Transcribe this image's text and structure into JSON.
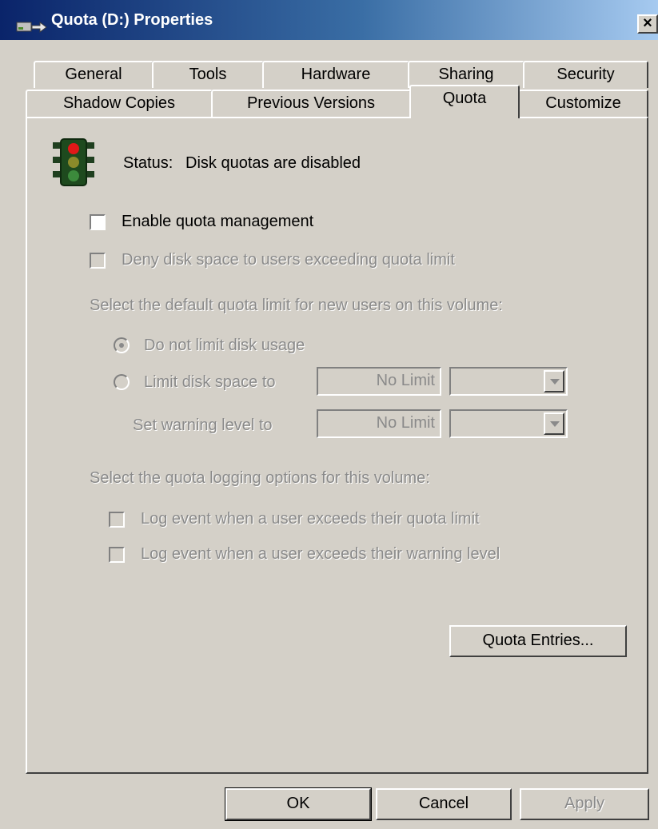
{
  "window": {
    "title": "Quota (D:) Properties",
    "close_glyph": "×"
  },
  "tabs": {
    "row1": [
      "General",
      "Tools",
      "Hardware",
      "Sharing",
      "Security"
    ],
    "row2": [
      "Shadow Copies",
      "Previous Versions",
      "Quota",
      "Customize"
    ],
    "selected": "Quota"
  },
  "quota": {
    "status_label": "Status:",
    "status_value": "Disk quotas are disabled",
    "status_icon": "traffic-light-icon",
    "enable_label": "Enable quota management",
    "enable_checked": false,
    "deny_label": "Deny disk space to users exceeding quota limit",
    "deny_checked": false,
    "default_limit_heading": "Select the default quota limit for new users on this volume:",
    "no_limit_label": "Do not limit disk usage",
    "no_limit_selected": true,
    "limit_label": "Limit disk space to",
    "limit_value": "No Limit",
    "warning_label": "Set warning level to",
    "warning_value": "No Limit",
    "logging_heading": "Select the quota logging options for this volume:",
    "log_limit_label": "Log event when a user exceeds their quota limit",
    "log_warning_label": "Log event when a user exceeds their warning level",
    "entries_button": "Quota Entries..."
  },
  "buttons": {
    "ok": "OK",
    "cancel": "Cancel",
    "apply": "Apply"
  },
  "colors": {
    "dialog_bg": "#d4d0c8",
    "titlebar_start": "#0a246a",
    "titlebar_end": "#a6caf0",
    "disabled_text": "#8a8a8a"
  }
}
